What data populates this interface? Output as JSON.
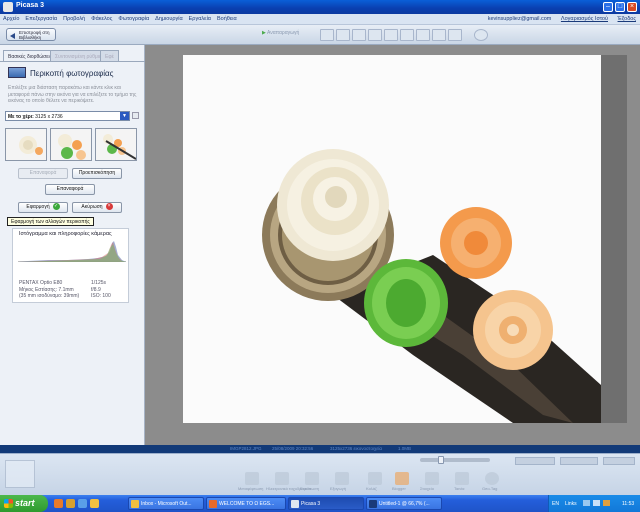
{
  "window": {
    "title": "Picasa 3"
  },
  "menu": {
    "items": [
      "Αρχείο",
      "Επεξεργασία",
      "Προβολή",
      "Φάκελος",
      "Φωτογραφία",
      "Δημιουργία",
      "Εργαλεία",
      "Βοήθεια"
    ],
    "account_email": "kevinsuppliez@gmail.com",
    "web_albums_link": "Λογαριασμός Ιστού",
    "signout_link": "Έξοδος"
  },
  "toolbar": {
    "back_label": "Επιστροφή στη Βιβλιοθήκη",
    "play_label": "Αναπαραγωγή"
  },
  "left_panel": {
    "tabs": [
      "Βασικές διορθώσεις",
      "Συντονισμένη ρύθμιση",
      "Εφέ"
    ],
    "crop_title": "Περικοπή φωτογραφίας",
    "crop_description": "Επιλέξτε μια διάσταση παρακάτω και κάντε κλικ και μεταφορά πάνω στην εικόνα για να επιλέξετε το τμήμα της εικόνας το οποίο θέλετε να περικόψετε.",
    "ratio_prefix": "Με το χέρι:",
    "ratio_value": "3125 x 2736",
    "reset_label": "Επαναφορά",
    "preview_label": "Προεπισκόπηση",
    "undo_label": "Επαναφορά",
    "apply_label": "Εφαρμογή",
    "cancel_label": "Ακύρωση",
    "tooltip": "Εφαρμογή των αλλαγών περικοπής",
    "histogram_title": "Ιστόγραμμα και πληροφορίες κάμερας",
    "camera_left": [
      "PENTAX Optio E80",
      "Μήκος Εστίασης: 7.1mm",
      "(35 mm ισοδύναμο: 39mm)"
    ],
    "camera_right": [
      "1/125s",
      "f/8.9",
      "ISO: 100"
    ]
  },
  "info_bar": {
    "items": [
      "IMGP2812.JPG",
      "25/08/2009 20:32:56",
      "3125x2736 εικονοστοιχεία",
      "1.0MB"
    ]
  },
  "tray": {
    "labels": [
      "Μεταφόρτωση",
      "Ηλεκτρονικό ταχυδρομείο",
      "Εκτύπωση",
      "Εξαγωγή",
      "Κολάζ",
      "Blogger",
      "Στοιχείο",
      "Ταινία",
      "Geo-Tag"
    ]
  },
  "taskbar": {
    "start_label": "start",
    "tasks": [
      "Inbox - Microsoft Out...",
      "WELCOME TO Ω EGS...",
      "Picasa 3",
      "Untitled-1 @ 66,7% (..."
    ],
    "language": "EN",
    "links_label": "Links",
    "clock": "11:53"
  },
  "colors": {
    "taskbar_blue": "#245edb",
    "start_green": "#2e9a2e",
    "title_blue": "#0a3fb0",
    "view_gray": "#8c8c8c"
  }
}
